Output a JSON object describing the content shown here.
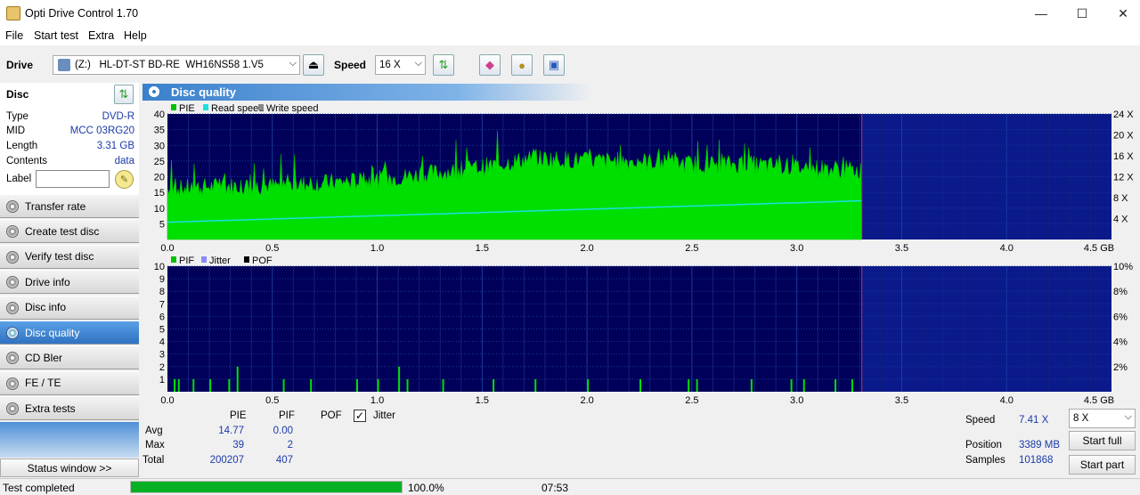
{
  "window": {
    "title": "Opti Drive Control 1.70",
    "minimize": "—",
    "maximize": "☐",
    "close": "✕"
  },
  "menu": [
    "File",
    "Start test",
    "Extra",
    "Help"
  ],
  "toolbar": {
    "drive_label": "Drive",
    "drive_value": "(Z:)   HL-DT-ST BD-RE  WH16NS58 1.V5",
    "speed_label": "Speed",
    "speed_value": "16 X",
    "icons": [
      "eject-icon",
      "refresh-icon",
      "eraser-icon",
      "copy-icon",
      "save-icon"
    ]
  },
  "disc": {
    "title": "Disc",
    "rows": [
      {
        "label": "Type",
        "value": "DVD-R"
      },
      {
        "label": "MID",
        "value": "MCC 03RG20"
      },
      {
        "label": "Length",
        "value": "3.31 GB"
      },
      {
        "label": "Contents",
        "value": "data"
      }
    ],
    "label_field": "Label",
    "label_value": ""
  },
  "sidebar": [
    {
      "label": "Transfer rate",
      "active": false
    },
    {
      "label": "Create test disc",
      "active": false
    },
    {
      "label": "Verify test disc",
      "active": false
    },
    {
      "label": "Drive info",
      "active": false
    },
    {
      "label": "Disc info",
      "active": false
    },
    {
      "label": "Disc quality",
      "active": true
    },
    {
      "label": "CD Bler",
      "active": false
    },
    {
      "label": "FE / TE",
      "active": false
    },
    {
      "label": "Extra tests",
      "active": false
    }
  ],
  "status_window_button": "Status window >>",
  "section_title": "Disc quality",
  "chart_data": [
    {
      "type": "area",
      "legend": [
        "PIE",
        "Read speed",
        "Write speed"
      ],
      "x_ticks": [
        "0.0",
        "0.5",
        "1.0",
        "1.5",
        "2.0",
        "2.5",
        "3.0",
        "3.5",
        "4.0",
        "4.5 GB"
      ],
      "y_ticks": [
        "5",
        "10",
        "15",
        "20",
        "25",
        "30",
        "35",
        "40"
      ],
      "y2_ticks": [
        "4 X",
        "8 X",
        "12 X",
        "16 X",
        "20 X",
        "24 X"
      ],
      "xlim": [
        0,
        4.5
      ],
      "ylim": [
        0,
        40
      ],
      "y2lim": [
        0,
        24
      ],
      "series": [
        {
          "name": "PIE",
          "x": [
            0.0,
            0.25,
            0.5,
            0.75,
            1.0,
            1.25,
            1.5,
            1.75,
            2.0,
            2.25,
            2.5,
            2.75,
            3.0,
            3.31
          ],
          "values": [
            16,
            17,
            17,
            18,
            19,
            21,
            23,
            26,
            25,
            25,
            24,
            24,
            23,
            22
          ]
        },
        {
          "name": "Read speed",
          "x": [
            0.0,
            3.31
          ],
          "values": [
            3.3,
            7.4
          ]
        }
      ],
      "colors": {
        "pie": "#00e000",
        "read": "#19e0e0",
        "write": "#888888",
        "bg": "#00005a",
        "marker": "#cc3366"
      },
      "end_marker": 3.31
    },
    {
      "type": "bar",
      "legend": [
        "PIF",
        "Jitter",
        "POF"
      ],
      "x_ticks": [
        "0.0",
        "0.5",
        "1.0",
        "1.5",
        "2.0",
        "2.5",
        "3.0",
        "3.5",
        "4.0",
        "4.5 GB"
      ],
      "y_ticks": [
        "1",
        "2",
        "3",
        "4",
        "5",
        "6",
        "7",
        "8",
        "9",
        "10"
      ],
      "y2_ticks": [
        "2%",
        "4%",
        "6%",
        "8%",
        "10%"
      ],
      "xlim": [
        0,
        4.5
      ],
      "ylim": [
        0,
        10
      ],
      "series": [
        {
          "name": "PIF",
          "x": [
            0.03,
            0.05,
            0.12,
            0.2,
            0.29,
            0.33,
            0.55,
            0.68,
            0.9,
            1.0,
            1.1,
            1.14,
            1.31,
            1.55,
            1.75,
            2.0,
            2.25,
            2.48,
            2.52,
            2.78,
            2.97,
            3.03,
            3.18,
            3.26
          ],
          "values": [
            1,
            1,
            1,
            1,
            1,
            2,
            1,
            1,
            1,
            1,
            2,
            1,
            1,
            1,
            1,
            1,
            1,
            1,
            1,
            1,
            1,
            1,
            1,
            1
          ]
        }
      ],
      "end_marker": 3.31
    }
  ],
  "stats": {
    "headers": [
      "PIE",
      "PIF",
      "POF"
    ],
    "jitter_label": "Jitter",
    "jitter_checked": true,
    "rows": [
      {
        "label": "Avg",
        "pie": "14.77",
        "pif": "0.00"
      },
      {
        "label": "Max",
        "pie": "39",
        "pif": "2"
      },
      {
        "label": "Total",
        "pie": "200207",
        "pif": "407"
      }
    ]
  },
  "right_info": {
    "speed_label": "Speed",
    "speed_value": "7.41 X",
    "speed_select": "8 X",
    "position_label": "Position",
    "position_value": "3389 MB",
    "samples_label": "Samples",
    "samples_value": "101868",
    "start_full": "Start full",
    "start_part": "Start part"
  },
  "status": {
    "text": "Test completed",
    "progress": 1.0,
    "percent": "100.0%",
    "time": "07:53"
  }
}
